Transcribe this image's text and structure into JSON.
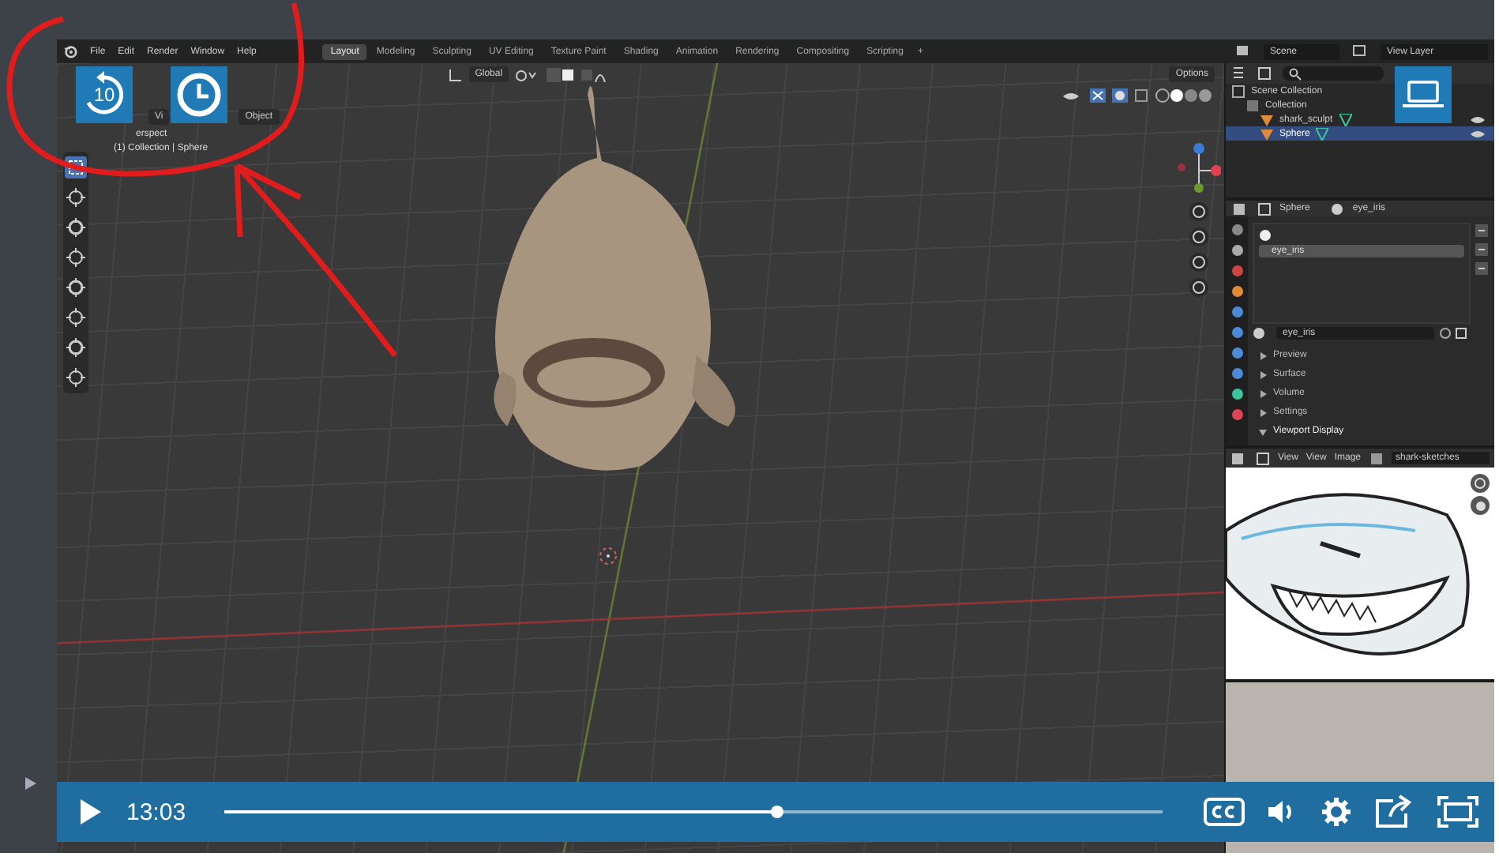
{
  "blender": {
    "menu": [
      "File",
      "Edit",
      "Render",
      "Window",
      "Help"
    ],
    "workspace_tabs": [
      {
        "label": "Layout",
        "selected": true
      },
      {
        "label": "Modeling",
        "selected": false
      },
      {
        "label": "Sculpting",
        "selected": false
      },
      {
        "label": "UV Editing",
        "selected": false
      },
      {
        "label": "Texture Paint",
        "selected": false
      },
      {
        "label": "Shading",
        "selected": false
      },
      {
        "label": "Animation",
        "selected": false
      },
      {
        "label": "Rendering",
        "selected": false
      },
      {
        "label": "Compositing",
        "selected": false
      },
      {
        "label": "Scripting",
        "selected": false
      }
    ],
    "add_tab": "+",
    "scene": "Scene",
    "view_layer": "View Layer",
    "viewport": {
      "menu": [
        "Vi",
        "Object"
      ],
      "orientation": "Global",
      "options": "Options",
      "view_name": "erspect",
      "collection_info": "(1) Collection | Sphere"
    },
    "outliner": {
      "items": [
        {
          "label": "Scene Collection",
          "selected": false,
          "children": [
            {
              "label": "Collection",
              "selected": false,
              "children": [
                {
                  "label": "shark_sculpt",
                  "selected": false
                },
                {
                  "label": "Sphere",
                  "selected": true
                }
              ]
            }
          ]
        }
      ]
    },
    "properties": {
      "object": "Sphere",
      "material": "eye_iris",
      "slots": [
        {
          "label": "eye_iris",
          "selected": true
        }
      ],
      "material_field": "eye_iris",
      "sections": [
        {
          "label": "Preview",
          "expanded": false
        },
        {
          "label": "Surface",
          "expanded": false
        },
        {
          "label": "Volume",
          "expanded": false
        },
        {
          "label": "Settings",
          "expanded": false
        },
        {
          "label": "Viewport Display",
          "expanded": true
        }
      ]
    },
    "image_editor": {
      "menu": [
        "View",
        "View",
        "Image"
      ],
      "image_name": "shark-sketches"
    }
  },
  "player": {
    "rewind": "10",
    "time": "13:03",
    "progress": {
      "level": 0.59
    }
  }
}
